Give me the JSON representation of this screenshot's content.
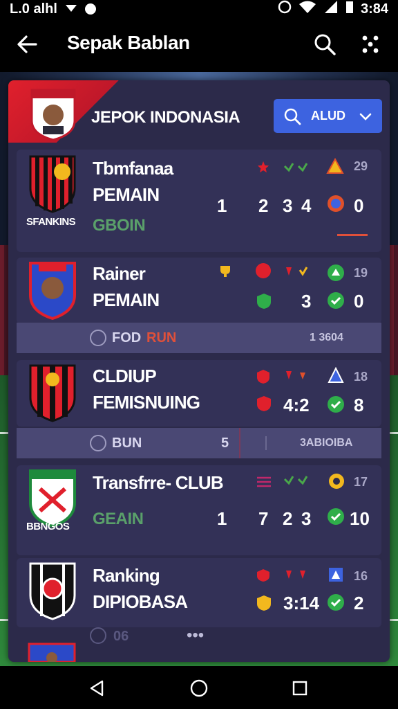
{
  "status": {
    "left_text": "L.0 alhl",
    "time": "3:84"
  },
  "appbar": {
    "title": "Sepak Bablan"
  },
  "header": {
    "title": "JEPOK INDONASIA",
    "filter_label": "ALUD"
  },
  "cards": [
    {
      "name1": "Tbmfanaa",
      "name2": "PEMAIN",
      "name3": "GBOIN",
      "under": "SFANKINS",
      "nums": [
        "1",
        "2",
        "3",
        "4",
        "0"
      ],
      "small": "29",
      "crest_colors": [
        "#e0202c",
        "#111"
      ]
    },
    {
      "name1": "Rainer",
      "name2": "PEMAIN",
      "nums": [
        "3",
        "0"
      ],
      "small": "19",
      "crest_colors": [
        "#2b49c8",
        "#e0202c"
      ]
    },
    {
      "name1": "CLDIUP",
      "name2": "FEMISNUING",
      "nums": [
        "4:2",
        "8"
      ],
      "small": "18",
      "crest_colors": [
        "#e0202c",
        "#111"
      ]
    },
    {
      "name1": "Transfrre- CLUB",
      "name3": "GEAIN",
      "under": "BBNGOS",
      "nums": [
        "1",
        "7",
        "2",
        "3",
        "10"
      ],
      "small": "17",
      "crest_colors": [
        "#1e8a3c",
        "#e0202c"
      ]
    },
    {
      "name1": "Ranking",
      "name2": "DIPIOBASA",
      "nums": [
        "3:14",
        "2"
      ],
      "small": "16",
      "crest_colors": [
        "#111",
        "#e0202c"
      ]
    }
  ],
  "subbars": [
    {
      "label_a": "FOD",
      "label_b": "RUN",
      "value": "1 3604"
    },
    {
      "label_a": "BUN",
      "left_num": "5",
      "value": "3ABIOIBA"
    }
  ],
  "footer_row": {
    "label": "06",
    "dots": "•••"
  },
  "colors": {
    "accent": "#3d63e0",
    "win": "#2fae4a",
    "panel": "#2c2a4a"
  }
}
